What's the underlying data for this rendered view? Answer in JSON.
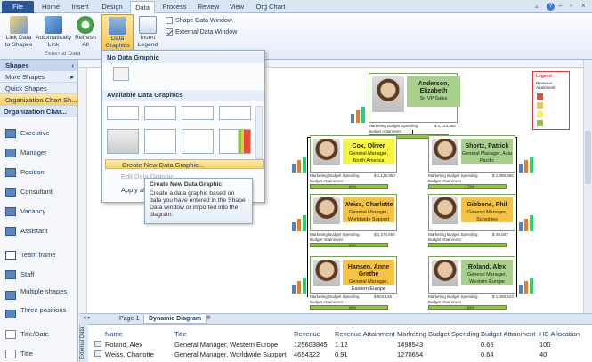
{
  "tabs": [
    "File",
    "Home",
    "Insert",
    "Design",
    "Data",
    "Process",
    "Review",
    "View",
    "Org Chart"
  ],
  "active_tab": "Data",
  "ribbon": {
    "buttons": [
      {
        "label": "Link Data to Shapes"
      },
      {
        "label": "Automatically Link"
      },
      {
        "label": "Refresh All"
      },
      {
        "label": "Data Graphics"
      },
      {
        "label": "Insert Legend"
      }
    ],
    "group_label": "External Data",
    "checkboxes": [
      {
        "label": "Shape Data Window",
        "checked": false
      },
      {
        "label": "External Data Window",
        "checked": true
      }
    ]
  },
  "dropdown": {
    "section1": "No Data Graphic",
    "section2": "Available Data Graphics",
    "items": [
      "Create New Data Graphic...",
      "Edit Data Graphic...",
      "Apply af"
    ],
    "tooltip_title": "Create New Data Graphic",
    "tooltip_text": "Create a data graphic based on data you have entered in the Shape Data window or imported into the diagram."
  },
  "shapes_pane": {
    "title": "Shapes",
    "sections": [
      "More Shapes",
      "Quick Shapes",
      "Organization Chart Sh..."
    ],
    "stencil_title": "Organization Char...",
    "items": [
      "Executive",
      "Manager",
      "Position",
      "Consultant",
      "Vacancy",
      "Assistant",
      "Team frame",
      "Staff",
      "Multiple shapes",
      "Three positions",
      "Title/Date",
      "Title"
    ]
  },
  "page_tabs": [
    "Page-1",
    "Dynamic Diagram"
  ],
  "data_window": {
    "side_label": "External Data",
    "columns": [
      "Name",
      "Title",
      "Revenue",
      "Revenue Attainment",
      "Marketing Budget Spending",
      "Budget Attainment",
      "HC Allocation"
    ],
    "rows": [
      [
        "Roland, Alex",
        "General Manager, Western Europe",
        "125603845",
        "1.12",
        "1498543",
        "0.65",
        "100"
      ],
      [
        "Weiss, Charlotte",
        "General Manager, Worldwide Support",
        "4654322",
        "0.91",
        "1270654",
        "0.64",
        "40"
      ]
    ]
  },
  "org_chart": {
    "nodes": [
      {
        "name": "Anderson, Elizabeth",
        "title": "Sr. VP Sales",
        "budget": "Marketing Budget Spending",
        "amount": "$ 1,123,360",
        "pct": "",
        "color": "#a8d08d"
      },
      {
        "name": "Cox, Oliver",
        "title": "General Manager, North America",
        "budget": "Marketing Budget Spending",
        "amount": "$ 1,126,960",
        "pct": "61%",
        "color": "#f5f542"
      },
      {
        "name": "Shortz, Patrick",
        "title": "General Manager, Asia Pacific",
        "budget": "Marketing Budget Spending",
        "amount": "$ 1,088,565",
        "pct": "73%",
        "color": "#a8d08d"
      },
      {
        "name": "Weiss, Charlotte",
        "title": "General Manager, Worldwide Support",
        "budget": "Marketing Budget Spending",
        "amount": "$ 1,270,654",
        "pct": "64%",
        "color": "#f5c242"
      },
      {
        "name": "Gibbons, Phil",
        "title": "General Manager, Subsidies",
        "budget": "Marketing Budget Spending",
        "amount": "$ 49,087",
        "pct": "",
        "color": "#f5c242"
      },
      {
        "name": "Hansen, Anne Grethe",
        "title": "General Manager, Eastern Europe",
        "budget": "Marketing Budget Spending",
        "amount": "$ 504,126",
        "pct": "68%",
        "color": "#f5c242"
      },
      {
        "name": "Roland, Alex",
        "title": "General Manager, Western Europe",
        "budget": "Marketing Budget Spending",
        "amount": "$ 1,498,543",
        "pct": "65%",
        "color": "#a8d08d"
      }
    ],
    "budget_attainment_label": "Budget Attainment",
    "legend_title": "Legend",
    "legend_sub": "Revenue Attainment"
  },
  "colors": {
    "file_tab": "#2b5797",
    "accent": "#f8c74f",
    "green": "#8fc63f"
  }
}
